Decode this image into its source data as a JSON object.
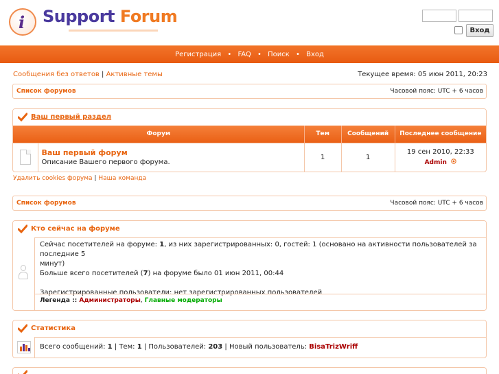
{
  "header": {
    "logo_word1": "Support",
    "logo_word2": "Forum",
    "logo_letter": "i",
    "login_button": "Вход"
  },
  "nav": {
    "items": [
      "Регистрация",
      "FAQ",
      "Поиск",
      "Вход"
    ],
    "separator": "•"
  },
  "top_links": {
    "unanswered": "Сообщения без ответов",
    "divider": "|",
    "active": "Активные темы",
    "current_time": "Текущее время: 05 июн 2011, 20:23"
  },
  "breadcrumb": {
    "label": "Список форумов",
    "timezone": "Часовой пояс: UTC + 6 часов"
  },
  "section": {
    "title": "Ваш первый раздел",
    "columns": [
      "Форум",
      "Тем",
      "Сообщений",
      "Последнее сообщение"
    ],
    "forum": {
      "name": "Ваш первый форум",
      "description": "Описание Вашего первого форума.",
      "topics": "1",
      "posts": "1",
      "last_date": "19 сен 2010, 22:33",
      "last_author": "Admin"
    }
  },
  "footer_links": {
    "delete_cookies": "Удалить cookies форума",
    "divider": "|",
    "team": "Наша команда"
  },
  "online": {
    "title": "Кто сейчас на форуме",
    "line1_prefix": "Сейчас посетителей на форуме: ",
    "line1_count": "1",
    "line1_suffix": ", из них зарегистрированных: 0, гостей: 1 (основано на активности пользователей за последние 5",
    "line1_cont": "минут)",
    "line2_prefix": "Больше всего посетителей (",
    "line2_count": "7",
    "line2_suffix": ") на форуме было 01 июн 2011, 00:44",
    "registered": "Зарегистрированные пользователи: нет зарегистрированных пользователей",
    "legend_label": "Легенда :: ",
    "legend_admins": "Администраторы",
    "legend_comma": ", ",
    "legend_mods": "Главные модераторы"
  },
  "stats": {
    "title": "Статистика",
    "p1": "Всего сообщений: ",
    "v1": "1",
    "p2": " | Тем: ",
    "v2": "1",
    "p3": " | Пользователей: ",
    "v3": "203",
    "p4": " | Новый пользователь: ",
    "newest": "BisaTrizWriff"
  },
  "colors": {
    "accent": "#e8640f",
    "nav_bg": "#ee6a1e",
    "admin": "#aa0000",
    "mod": "#00aa00",
    "border": "#f4c7a9"
  }
}
